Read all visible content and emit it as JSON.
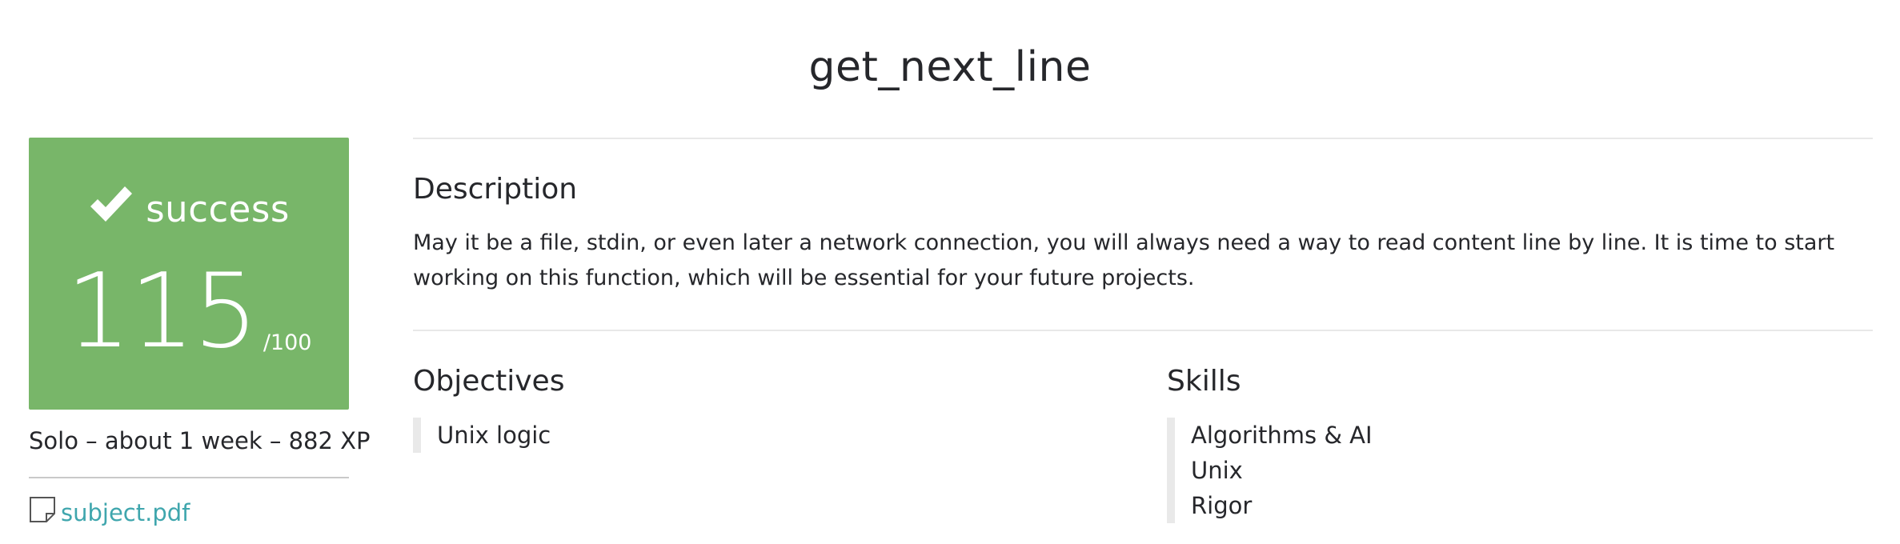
{
  "project": {
    "title": "get_next_line"
  },
  "result": {
    "status": "success",
    "status_icon": "check-icon",
    "score": "115",
    "score_max": "/100",
    "color": "#78b669"
  },
  "meta": {
    "info": "Solo – about 1 week – 882 XP"
  },
  "attachment": {
    "icon": "document-icon",
    "label": "subject.pdf",
    "color": "#3fa6ad"
  },
  "description": {
    "heading": "Description",
    "text": "May it be a file, stdin, or even later a network connection, you will always need a way to read content line by line. It is time to start working on this function, which will be essential for your future projects."
  },
  "objectives": {
    "heading": "Objectives",
    "items": [
      "Unix logic"
    ]
  },
  "skills": {
    "heading": "Skills",
    "items": [
      "Algorithms & AI",
      "Unix",
      "Rigor"
    ]
  }
}
